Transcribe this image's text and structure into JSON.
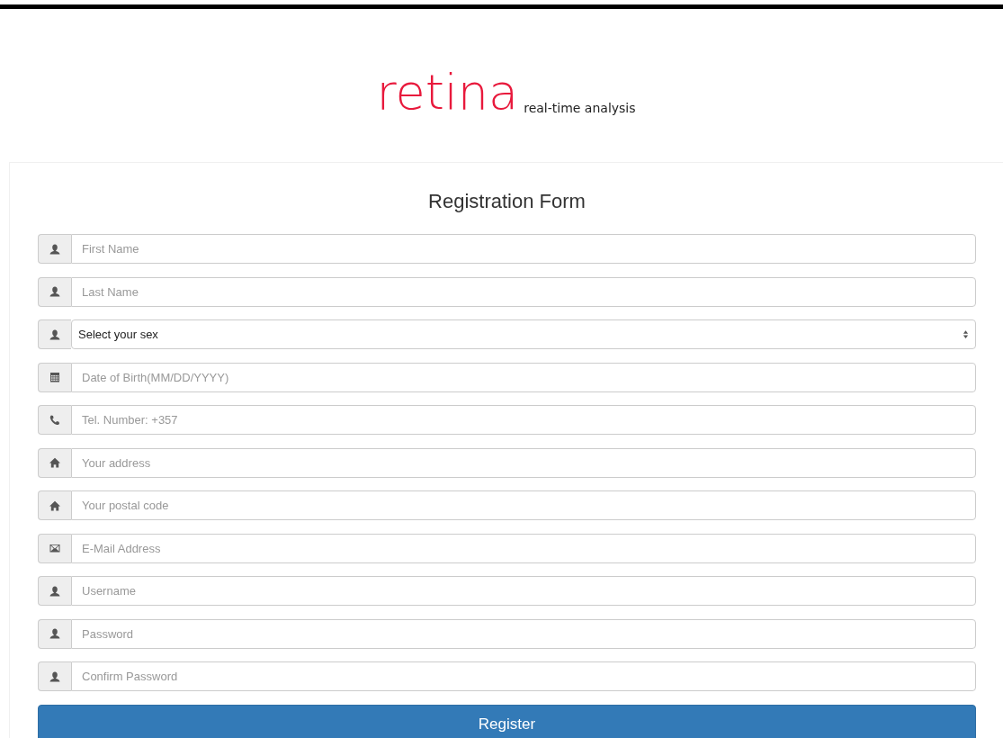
{
  "logo": {
    "name": "retina",
    "tagline": "real-time analysis"
  },
  "form": {
    "title": "Registration Form",
    "fields": [
      {
        "kind": "text",
        "placeholder": "First Name"
      },
      {
        "kind": "text",
        "placeholder": "Last Name"
      },
      {
        "kind": "select",
        "value": "Select your sex"
      },
      {
        "kind": "text",
        "placeholder": "Date of Birth(MM/DD/YYYY)"
      },
      {
        "kind": "text",
        "placeholder": "Tel. Number: +357"
      },
      {
        "kind": "text",
        "placeholder": "Your address"
      },
      {
        "kind": "text",
        "placeholder": "Your postal code"
      },
      {
        "kind": "text",
        "placeholder": "E-Mail Address"
      },
      {
        "kind": "text",
        "placeholder": "Username"
      },
      {
        "kind": "text",
        "placeholder": "Password"
      },
      {
        "kind": "text",
        "placeholder": "Confirm Password"
      }
    ],
    "submit": "Register"
  }
}
